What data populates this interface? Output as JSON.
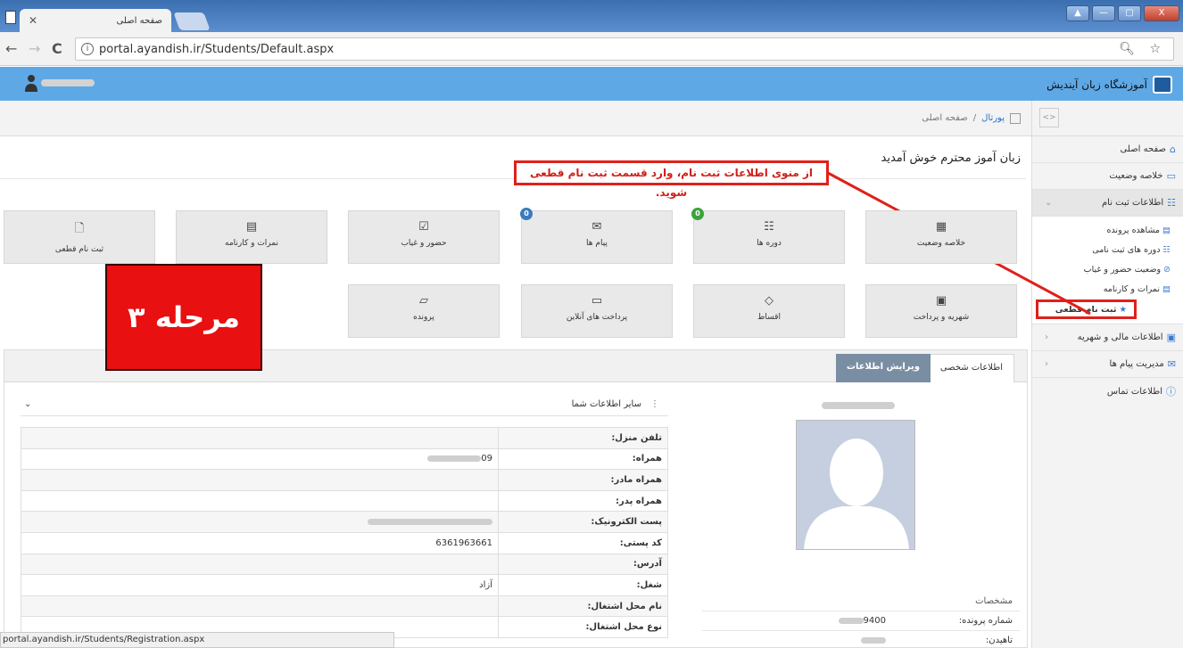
{
  "browser": {
    "tab_title": "صفحه اصلی",
    "tab_close": "✕",
    "url": "portal.ayandish.ir/Students/Default.aspx",
    "back_icon": "←",
    "forward_icon": "→",
    "reload_icon": "C",
    "info_icon": "i",
    "url_tools": "🔍︎ ☆",
    "window_buttons": [
      "▲",
      "—",
      "▢",
      "X"
    ],
    "status_url": "portal.ayandish.ir/Students/Registration.aspx"
  },
  "header": {
    "brand": "آموزشگاه زبان آیندیش"
  },
  "breadcrumb": {
    "home": "پورتال",
    "separator": "/",
    "current": "صفحه اصلی"
  },
  "sidebar": {
    "toggle_icon": "<>",
    "items": [
      {
        "label": "صفحه اصلی",
        "icon": "⌂"
      },
      {
        "label": "خلاصه وضعیت",
        "icon": "▭"
      },
      {
        "label": "اطلاعات ثبت نام",
        "icon": "☷",
        "arrow": "⌄"
      }
    ],
    "subitems": [
      {
        "label": "مشاهده پرونده",
        "icon": "▤"
      },
      {
        "label": "دوره های ثبت نامی",
        "icon": "☷"
      },
      {
        "label": "وضعیت حضور و غیاب",
        "icon": "⊘"
      },
      {
        "label": "نمرات و کارنامه",
        "icon": "▤"
      },
      {
        "label": "ثبت نام قطعی",
        "icon": "★"
      }
    ],
    "bottom_items": [
      {
        "label": "اطلاعات مالی و شهریه",
        "icon": "▣",
        "arrow": "‹"
      },
      {
        "label": "مدیریت پیام ها",
        "icon": "✉",
        "arrow": "‹"
      },
      {
        "label": "اطلاعات تماس",
        "icon": "ⓘ"
      }
    ]
  },
  "main": {
    "welcome": "زبان آموز محترم خوش آمدید",
    "callout": "از منوی اطلاعات ثبت نام، وارد قسمت ثبت نام قطعی شوید.",
    "stage": "مرحله ۳",
    "tiles_row1": [
      {
        "label": "خلاصه وضعیت",
        "icon": "▦"
      },
      {
        "label": "دوره ها",
        "icon": "☷",
        "badge": "0"
      },
      {
        "label": "پیام ها",
        "icon": "✉",
        "badge": "0"
      },
      {
        "label": "حضور و غیاب",
        "icon": "☑"
      },
      {
        "label": "نمرات و کارنامه",
        "icon": "▤"
      },
      {
        "label": "ثبت نام قطعی",
        "icon": "🗋"
      }
    ],
    "tiles_row2": [
      {
        "label": "شهریه و پرداخت",
        "icon": "▣"
      },
      {
        "label": "اقساط",
        "icon": "◇"
      },
      {
        "label": "پرداخت های آنلاین",
        "icon": "▭"
      },
      {
        "label": "پرونده",
        "icon": "▱"
      }
    ]
  },
  "panel": {
    "tab_personal": "اطلاعات شخصی",
    "tab_edit": "ویرایش اطلاعات",
    "specs_title": "مشخصات",
    "spec_rows": [
      {
        "key": "شماره پرونده:",
        "value": "9400"
      },
      {
        "key": "تاهیدن:",
        "value": ""
      }
    ],
    "info_title": "سایر اطلاعات شما",
    "info_menu_icon": "⋮",
    "info_chevron": "⌄",
    "info_rows": [
      {
        "key": "تلفن منزل:",
        "value": ""
      },
      {
        "key": "همراه:",
        "value": "09"
      },
      {
        "key": "همراه مادر:",
        "value": ""
      },
      {
        "key": "همراه پدر:",
        "value": ""
      },
      {
        "key": "پست الکترونیک:",
        "value": ""
      },
      {
        "key": "کد پستی:",
        "value": "6361963661"
      },
      {
        "key": "آدرس:",
        "value": ""
      },
      {
        "key": "شغل:",
        "value": "آزاد"
      },
      {
        "key": "نام محل اشتغال:",
        "value": ""
      },
      {
        "key": "نوع محل اشتغال:",
        "value": ""
      }
    ]
  },
  "colors": {
    "header_blue": "#5fa8e6",
    "annotation_red": "#e0201a",
    "stage_red": "#e81010",
    "badge_blue": "#3a7bbd",
    "badge_green": "#3ca23c"
  }
}
